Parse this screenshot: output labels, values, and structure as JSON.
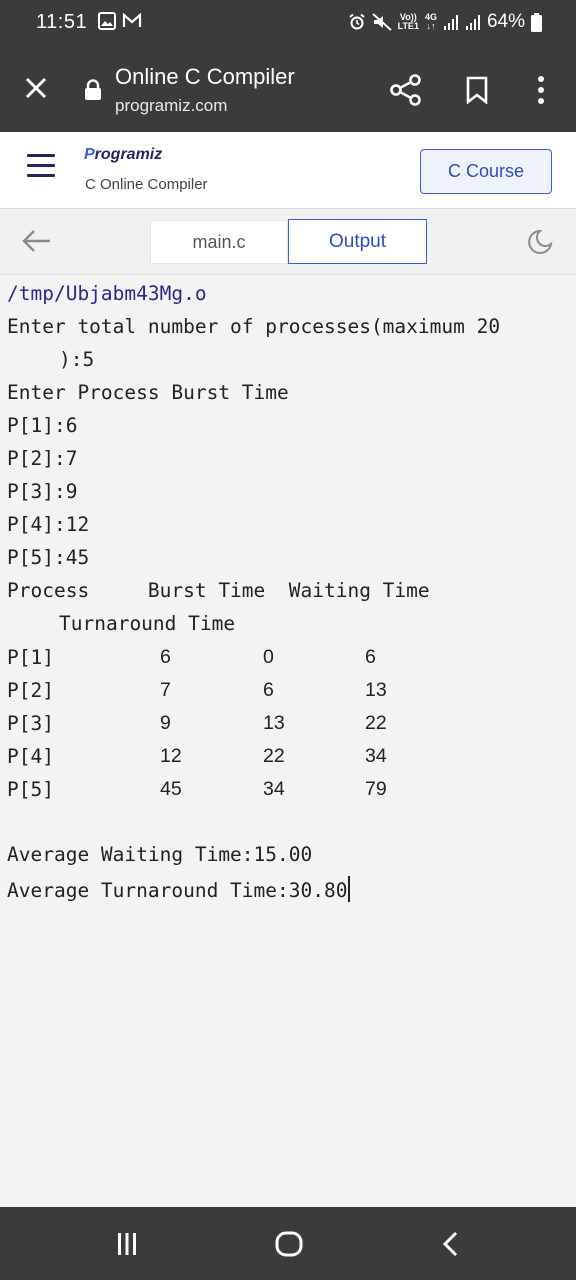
{
  "status_bar": {
    "time": "11:51",
    "volte_top": "Vo))",
    "volte_bottom": "LTE1",
    "network_top": "4G",
    "battery": "64%"
  },
  "browser": {
    "title": "Online C Compiler",
    "url": "programiz.com"
  },
  "site": {
    "logo": "Programiz",
    "subtitle": "C Online Compiler",
    "course_button": "C Course"
  },
  "editor": {
    "tabs": [
      {
        "label": "main.c",
        "active": false
      },
      {
        "label": "Output",
        "active": true
      }
    ]
  },
  "output": {
    "path": "/tmp/Ubjabm43Mg.o",
    "prompt_line1": "Enter total number of processes(maximum 20",
    "prompt_line2": "):5",
    "burst_prompt": "Enter Process Burst Time",
    "inputs": [
      "P[1]:6",
      "P[2]:7",
      "P[3]:9",
      "P[4]:12",
      "P[5]:45"
    ],
    "header_line1": "Process     Burst Time  Waiting Time",
    "header_line2": "Turnaround Time",
    "rows": [
      {
        "process": "P[1]",
        "burst": "6",
        "waiting": "0",
        "turnaround": "6"
      },
      {
        "process": "P[2]",
        "burst": "7",
        "waiting": "6",
        "turnaround": "13"
      },
      {
        "process": "P[3]",
        "burst": "9",
        "waiting": "13",
        "turnaround": "22"
      },
      {
        "process": "P[4]",
        "burst": "12",
        "waiting": "22",
        "turnaround": "34"
      },
      {
        "process": "P[5]",
        "burst": "45",
        "waiting": "34",
        "turnaround": "79"
      }
    ],
    "avg_waiting": "Average Waiting Time:15.00",
    "avg_turnaround": "Average Turnaround Time:30.80"
  },
  "colors": {
    "accent": "#3b5cd6",
    "bar": "#3b3b3b",
    "background": "#f3f3f3"
  },
  "icons": [
    "close-icon",
    "lock-icon",
    "share-icon",
    "bookmark-icon",
    "more-icon",
    "menu-icon",
    "back-arrow-icon",
    "moon-icon",
    "recents-icon",
    "home-icon",
    "back-icon"
  ]
}
